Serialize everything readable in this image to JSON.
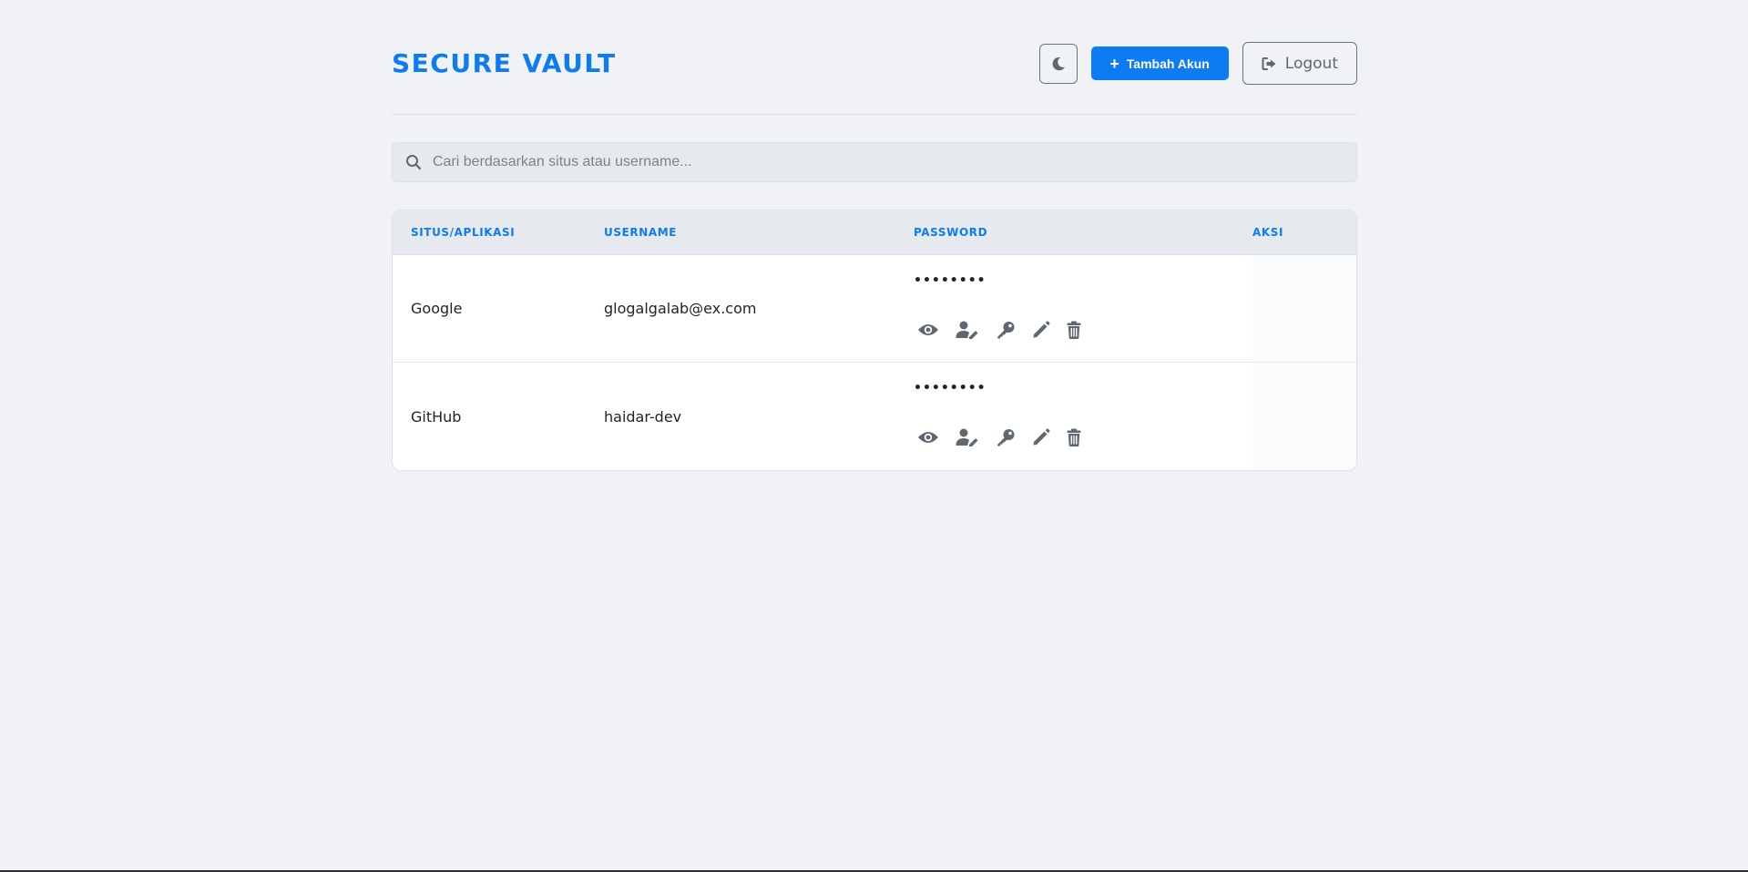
{
  "header": {
    "title": "SECURE VAULT",
    "add_button_label": "Tambah Akun",
    "logout_button_label": "Logout"
  },
  "search": {
    "placeholder": "Cari berdasarkan situs atau username...",
    "value": ""
  },
  "table": {
    "columns": {
      "site": "SITUS/APLIKASI",
      "username": "USERNAME",
      "password": "PASSWORD",
      "actions": "AKSI"
    },
    "rows": [
      {
        "site": "Google",
        "username": "glogalgalab@ex.com",
        "password_masked": "••••••••"
      },
      {
        "site": "GitHub",
        "username": "haidar-dev",
        "password_masked": "••••••••"
      }
    ],
    "row_icons": [
      "eye-icon",
      "user-edit-icon",
      "key-icon",
      "pencil-icon",
      "trash-icon"
    ]
  },
  "colors": {
    "accent": "#0d7bf2",
    "icon": "#5f6771",
    "background": "#f0f2f5"
  }
}
